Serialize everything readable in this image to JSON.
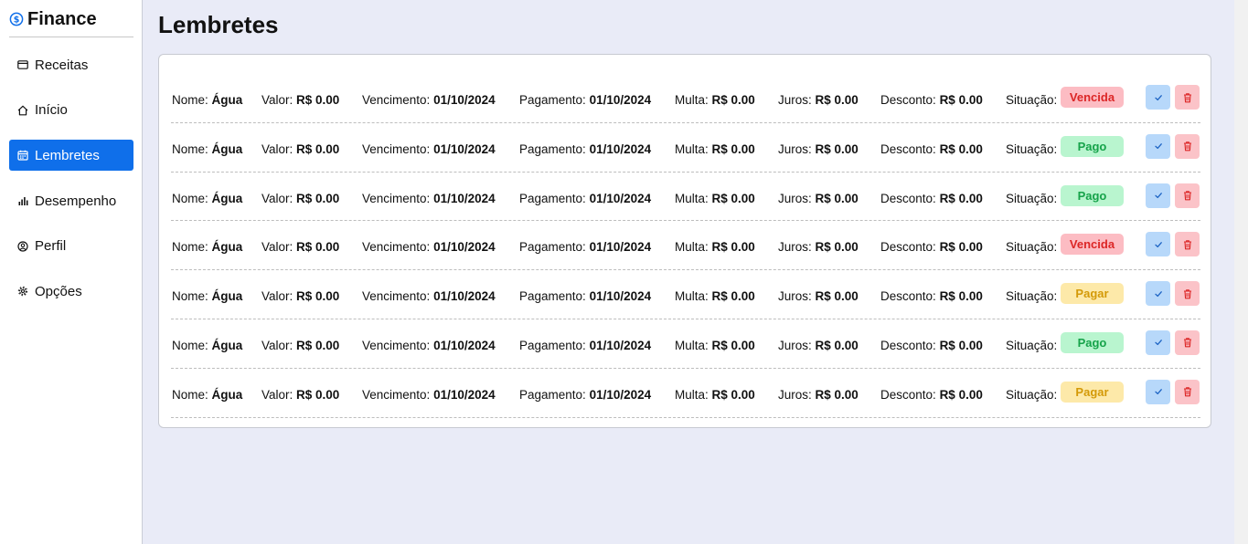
{
  "app": {
    "title": "Finance",
    "icon": "dollar-circle-icon",
    "accent": "#0f6fea"
  },
  "sidebar": {
    "items": [
      {
        "label": "Receitas",
        "icon": "wallet-icon",
        "active": false
      },
      {
        "label": "Início",
        "icon": "home-icon",
        "active": false
      },
      {
        "label": "Lembretes",
        "icon": "calendar-icon",
        "active": true
      },
      {
        "label": "Desempenho",
        "icon": "bar-chart-icon",
        "active": false
      },
      {
        "label": "Perfil",
        "icon": "user-circle-icon",
        "active": false
      },
      {
        "label": "Opções",
        "icon": "gear-icon",
        "active": false
      }
    ]
  },
  "main": {
    "title": "Lembretes",
    "labels": {
      "nome": "Nome:",
      "valor": "Valor:",
      "vencimento": "Vencimento:",
      "pagamento": "Pagamento:",
      "multa": "Multa:",
      "juros": "Juros:",
      "desconto": "Desconto:",
      "situacao": "Situação:"
    },
    "reminders": [
      {
        "nome": "Água",
        "valor": "R$ 0.00",
        "vencimento": "01/10/2024",
        "pagamento": "01/10/2024",
        "multa": "R$ 0.00",
        "juros": "R$ 0.00",
        "desconto": "R$ 0.00",
        "situacao": "Vencida",
        "status": "vencida"
      },
      {
        "nome": "Água",
        "valor": "R$ 0.00",
        "vencimento": "01/10/2024",
        "pagamento": "01/10/2024",
        "multa": "R$ 0.00",
        "juros": "R$ 0.00",
        "desconto": "R$ 0.00",
        "situacao": "Pago",
        "status": "pago"
      },
      {
        "nome": "Água",
        "valor": "R$ 0.00",
        "vencimento": "01/10/2024",
        "pagamento": "01/10/2024",
        "multa": "R$ 0.00",
        "juros": "R$ 0.00",
        "desconto": "R$ 0.00",
        "situacao": "Pago",
        "status": "pago"
      },
      {
        "nome": "Água",
        "valor": "R$ 0.00",
        "vencimento": "01/10/2024",
        "pagamento": "01/10/2024",
        "multa": "R$ 0.00",
        "juros": "R$ 0.00",
        "desconto": "R$ 0.00",
        "situacao": "Vencida",
        "status": "vencida"
      },
      {
        "nome": "Água",
        "valor": "R$ 0.00",
        "vencimento": "01/10/2024",
        "pagamento": "01/10/2024",
        "multa": "R$ 0.00",
        "juros": "R$ 0.00",
        "desconto": "R$ 0.00",
        "situacao": "Pagar",
        "status": "pagar"
      },
      {
        "nome": "Água",
        "valor": "R$ 0.00",
        "vencimento": "01/10/2024",
        "pagamento": "01/10/2024",
        "multa": "R$ 0.00",
        "juros": "R$ 0.00",
        "desconto": "R$ 0.00",
        "situacao": "Pago",
        "status": "pago"
      },
      {
        "nome": "Água",
        "valor": "R$ 0.00",
        "vencimento": "01/10/2024",
        "pagamento": "01/10/2024",
        "multa": "R$ 0.00",
        "juros": "R$ 0.00",
        "desconto": "R$ 0.00",
        "situacao": "Pagar",
        "status": "pagar"
      }
    ],
    "row_actions": {
      "confirm_icon": "check-icon",
      "delete_icon": "trash-icon"
    }
  },
  "colors": {
    "vencida_bg": "#fcbcc3",
    "vencida_text": "#dc2626",
    "pago_bg": "#b9f5cf",
    "pago_text": "#16a34a",
    "pagar_bg": "#fde9a9",
    "pagar_text": "#d49a08",
    "page_bg": "#e9ebf7"
  }
}
